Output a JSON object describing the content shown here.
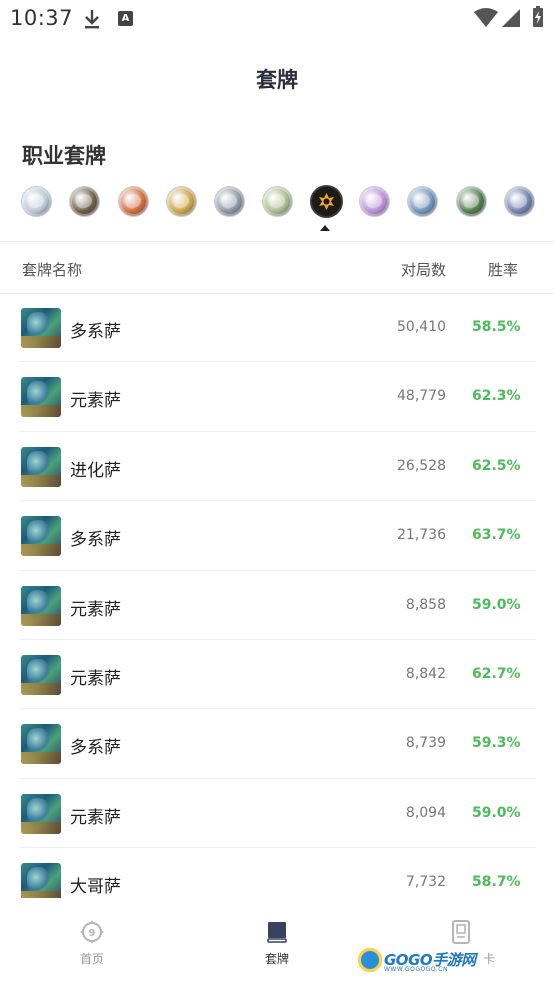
{
  "status_bar": {
    "time": "10:37",
    "a_icon": "A"
  },
  "header": {
    "title": "套牌"
  },
  "section": {
    "title": "职业套牌"
  },
  "class_icons": [
    {
      "icon": "class-icon",
      "color": "#b9c6d6"
    },
    {
      "icon": "class-icon",
      "color": "#6b5a44"
    },
    {
      "icon": "class-icon",
      "color": "#d06a3a"
    },
    {
      "icon": "class-icon",
      "color": "#c9a24a"
    },
    {
      "icon": "class-icon",
      "color": "#8a95a5"
    },
    {
      "icon": "class-icon",
      "color": "#a8b98a"
    },
    {
      "icon": "class-icon",
      "color": "#1f1a14",
      "active": true
    },
    {
      "icon": "class-icon",
      "color": "#b78fd6"
    },
    {
      "icon": "class-icon",
      "color": "#6f8fb8"
    },
    {
      "icon": "class-icon",
      "color": "#4f7a4a"
    },
    {
      "icon": "class-icon",
      "color": "#6e7fa8"
    }
  ],
  "table": {
    "headers": {
      "name": "套牌名称",
      "games": "对局数",
      "winrate": "胜率"
    },
    "rows": [
      {
        "name": "多系萨",
        "games": "50,410",
        "winrate": "58.5%"
      },
      {
        "name": "元素萨",
        "games": "48,779",
        "winrate": "62.3%"
      },
      {
        "name": "进化萨",
        "games": "26,528",
        "winrate": "62.5%"
      },
      {
        "name": "多系萨",
        "games": "21,736",
        "winrate": "63.7%"
      },
      {
        "name": "元素萨",
        "games": "8,858",
        "winrate": "59.0%"
      },
      {
        "name": "元素萨",
        "games": "8,842",
        "winrate": "62.7%"
      },
      {
        "name": "多系萨",
        "games": "8,739",
        "winrate": "59.3%"
      },
      {
        "name": "元素萨",
        "games": "8,094",
        "winrate": "59.0%"
      },
      {
        "name": "大哥萨",
        "games": "7,732",
        "winrate": "58.7%"
      }
    ]
  },
  "bottom_nav": {
    "home": "首页",
    "decks": "套牌",
    "cards": "卡"
  },
  "watermark": {
    "text": "GOGO手游网",
    "sub": "WWW.GOGOGO.CN"
  },
  "colors": {
    "winrate": "#4cbb58",
    "title": "#2b2f3e",
    "divider": "#ececee"
  }
}
